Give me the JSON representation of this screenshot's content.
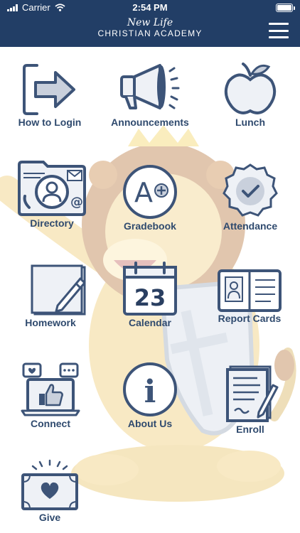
{
  "status_bar": {
    "carrier": "Carrier",
    "time": "2:54 PM"
  },
  "header": {
    "logo_script": "New Life",
    "logo_name": "CHRISTIAN ACADEMY",
    "menu_icon": "hamburger-menu-icon"
  },
  "colors": {
    "header_bg": "#223e66",
    "icon_stroke": "#3d5478",
    "icon_fill": "#eef1f6",
    "label": "#2f4a6e"
  },
  "tiles": [
    {
      "label": "How to Login",
      "icon": "login-arrow-icon"
    },
    {
      "label": "Announcements",
      "icon": "megaphone-icon"
    },
    {
      "label": "Lunch",
      "icon": "apple-icon"
    },
    {
      "label": "Directory",
      "icon": "directory-folder-icon"
    },
    {
      "label": "Gradebook",
      "icon": "a-plus-grade-icon"
    },
    {
      "label": "Attendance",
      "icon": "check-seal-icon"
    },
    {
      "label": "Homework",
      "icon": "homework-pencil-icon"
    },
    {
      "label": "Calendar",
      "icon": "calendar-icon",
      "day": "23"
    },
    {
      "label": "Report Cards",
      "icon": "report-card-icon"
    },
    {
      "label": "Connect",
      "icon": "social-laptop-icon"
    },
    {
      "label": "About Us",
      "icon": "info-icon",
      "glyph": "i"
    },
    {
      "label": "Enroll",
      "icon": "enroll-form-icon"
    },
    {
      "label": "Give",
      "icon": "give-heart-icon"
    }
  ]
}
